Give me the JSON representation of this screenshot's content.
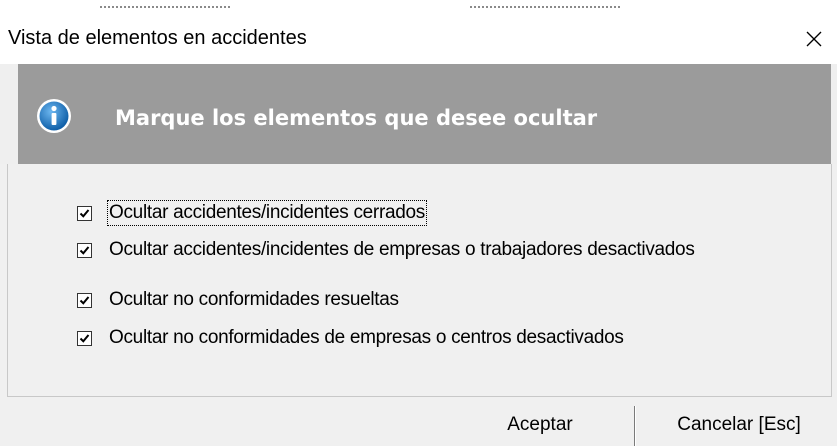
{
  "window": {
    "title": "Vista de elementos en accidentes",
    "close_glyph": "✕"
  },
  "header": {
    "icon": "info-icon",
    "text": "Marque los elementos que desee ocultar"
  },
  "options": [
    {
      "label": "Ocultar accidentes/incidentes cerrados",
      "checked": true,
      "focused": true
    },
    {
      "label": "Ocultar accidentes/incidentes de empresas o trabajadores desactivados",
      "checked": true,
      "focused": false
    },
    {
      "label": "Ocultar no conformidades resueltas",
      "checked": true,
      "focused": false
    },
    {
      "label": "Ocultar no conformidades de empresas o centros desactivados",
      "checked": true,
      "focused": false
    }
  ],
  "buttons": {
    "accept_label": "Aceptar",
    "cancel_label": "Cancelar [Esc]"
  },
  "colors": {
    "header_band": "#9b9b9b",
    "icon_blue": "#1f78c8"
  }
}
